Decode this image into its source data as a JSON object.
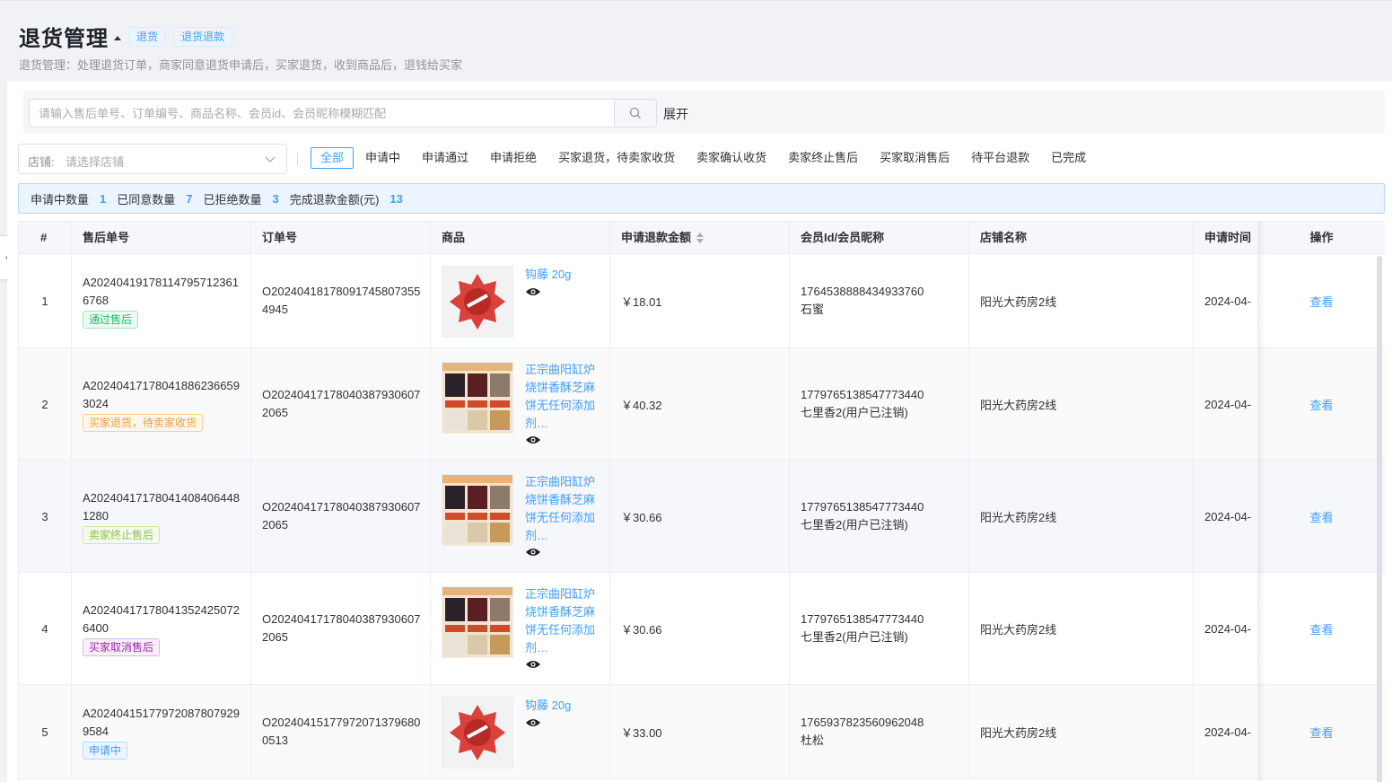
{
  "header": {
    "title": "退货管理",
    "tags": [
      "退货",
      "退货退款"
    ],
    "description": "退货管理：处理退货订单，商家同意退货申请后，买家退货，收到商品后，退钱给买家"
  },
  "search": {
    "placeholder": "请输入售后单号、订单编号、商品名称、会员id、会员昵称模糊匹配",
    "expand_label": "展开"
  },
  "shop_filter": {
    "label": "店铺:",
    "placeholder": "请选择店铺"
  },
  "status_tabs": [
    "全部",
    "申请中",
    "申请通过",
    "申请拒绝",
    "买家退货，待卖家收货",
    "卖家确认收货",
    "卖家终止售后",
    "买家取消售后",
    "待平台退款",
    "已完成"
  ],
  "stats": {
    "pending_label": "申请中数量",
    "pending_value": "1",
    "approved_label": "已同意数量",
    "approved_value": "7",
    "rejected_label": "已拒绝数量",
    "rejected_value": "3",
    "refund_label": "完成退款金额(元)",
    "refund_value": "13"
  },
  "table": {
    "columns": [
      "#",
      "售后单号",
      "订单号",
      "商品",
      "申请退款金额",
      "会员Id/会员昵称",
      "店铺名称",
      "申请时间",
      "操作"
    ],
    "rows": [
      {
        "index": "1",
        "aftersale_no": "A202404191781147957123616768",
        "status": "通过售后",
        "order_no": "O202404181780917458073554945",
        "product": "钩藤 20g",
        "amount": "￥18.01",
        "member_id": "1764538888434933760",
        "member_name": "石蜜",
        "shop": "阳光大药房2线",
        "time": "2024-04-",
        "action": "查看"
      },
      {
        "index": "2",
        "aftersale_no": "A202404171780418862366593024",
        "status": "买家退货，待卖家收货",
        "order_no": "O202404171780403879306072065",
        "product": "正宗曲阳缸炉烧饼香酥芝麻饼无任何添加剂…",
        "amount": "￥40.32",
        "member_id": "1779765138547773440",
        "member_name": "七里香2(用户已注销)",
        "shop": "阳光大药房2线",
        "time": "2024-04-",
        "action": "查看"
      },
      {
        "index": "3",
        "aftersale_no": "A202404171780414084064481280",
        "status": "卖家终止售后",
        "order_no": "O202404171780403879306072065",
        "product": "正宗曲阳缸炉烧饼香酥芝麻饼无任何添加剂…",
        "amount": "￥30.66",
        "member_id": "1779765138547773440",
        "member_name": "七里香2(用户已注销)",
        "shop": "阳光大药房2线",
        "time": "2024-04-",
        "action": "查看"
      },
      {
        "index": "4",
        "aftersale_no": "A202404171780413524250726400",
        "status": "买家取消售后",
        "order_no": "O202404171780403879306072065",
        "product": "正宗曲阳缸炉烧饼香酥芝麻饼无任何添加剂…",
        "amount": "￥30.66",
        "member_id": "1779765138547773440",
        "member_name": "七里香2(用户已注销)",
        "shop": "阳光大药房2线",
        "time": "2024-04-",
        "action": "查看"
      },
      {
        "index": "5",
        "aftersale_no": "A202404151779720878079299584",
        "status": "申请中",
        "order_no": "O202404151779720713796800513",
        "product": "钩藤 20g",
        "amount": "￥33.00",
        "member_id": "1765937823560962048",
        "member_name": "杜松",
        "shop": "阳光大药房2线",
        "time": "2024-04-",
        "action": "查看"
      }
    ]
  },
  "icons": {
    "search": "search-icon",
    "dropdown": "chevron-down-icon",
    "view_image": "eye-icon",
    "collapse": "chevron-left-icon",
    "sort": "sort-icon"
  },
  "colors": {
    "accent": "#409eff",
    "success": "#19be6b",
    "warning": "#e6a23c",
    "lime": "#8bc34a",
    "purple": "#9c27b0"
  }
}
